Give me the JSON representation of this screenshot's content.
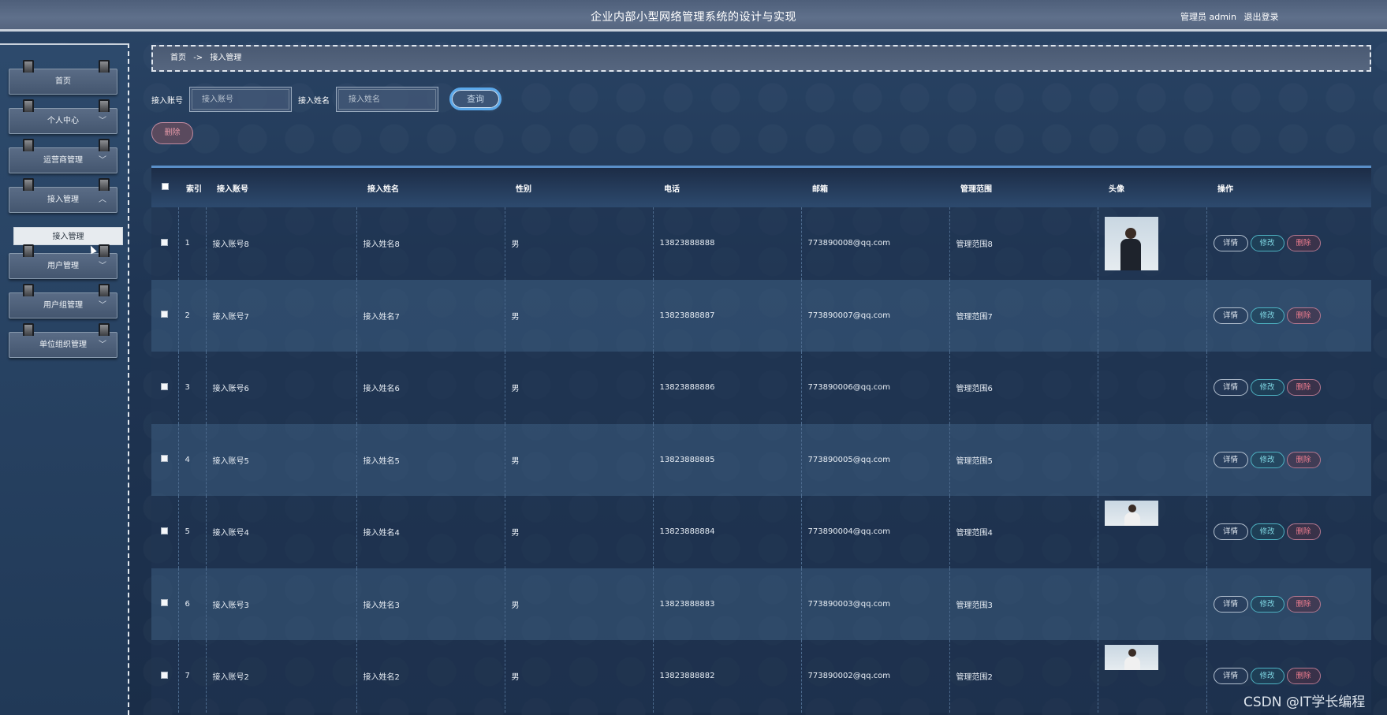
{
  "header": {
    "title": "企业内部小型网络管理系统的设计与实现",
    "user_label": "管理员 admin",
    "logout_label": "退出登录"
  },
  "sidebar": {
    "items": [
      {
        "label": "首页",
        "has_chevron": false
      },
      {
        "label": "个人中心",
        "chevron": "﹀"
      },
      {
        "label": "运营商管理",
        "chevron": "﹀"
      },
      {
        "label": "接入管理",
        "chevron": "︿"
      },
      {
        "label": "用户管理",
        "chevron": "﹀"
      },
      {
        "label": "用户组管理",
        "chevron": "﹀"
      },
      {
        "label": "单位组织管理",
        "chevron": "﹀"
      }
    ],
    "submenu": {
      "label": "接入管理"
    }
  },
  "breadcrumb": {
    "home": "首页",
    "separator": "->",
    "current": "接入管理"
  },
  "search": {
    "account_label": "接入账号",
    "account_placeholder": "接入账号",
    "name_label": "接入姓名",
    "name_placeholder": "接入姓名",
    "query_label": "查询"
  },
  "toolbar": {
    "delete_label": "删除"
  },
  "table": {
    "headers": [
      "索引",
      "接入账号",
      "接入姓名",
      "性别",
      "电话",
      "邮箱",
      "管理范围",
      "头像",
      "操作"
    ],
    "rows": [
      {
        "index": "1",
        "account": "接入账号8",
        "name": "接入姓名8",
        "gender": "男",
        "phone": "13823888888",
        "email": "773890008@qq.com",
        "scope": "管理范围8",
        "avatar": "tall"
      },
      {
        "index": "2",
        "account": "接入账号7",
        "name": "接入姓名7",
        "gender": "男",
        "phone": "13823888887",
        "email": "773890007@qq.com",
        "scope": "管理范围7",
        "avatar": "none"
      },
      {
        "index": "3",
        "account": "接入账号6",
        "name": "接入姓名6",
        "gender": "男",
        "phone": "13823888886",
        "email": "773890006@qq.com",
        "scope": "管理范围6",
        "avatar": "none"
      },
      {
        "index": "4",
        "account": "接入账号5",
        "name": "接入姓名5",
        "gender": "男",
        "phone": "13823888885",
        "email": "773890005@qq.com",
        "scope": "管理范围5",
        "avatar": "none"
      },
      {
        "index": "5",
        "account": "接入账号4",
        "name": "接入姓名4",
        "gender": "男",
        "phone": "13823888884",
        "email": "773890004@qq.com",
        "scope": "管理范围4",
        "avatar": "short"
      },
      {
        "index": "6",
        "account": "接入账号3",
        "name": "接入姓名3",
        "gender": "男",
        "phone": "13823888883",
        "email": "773890003@qq.com",
        "scope": "管理范围3",
        "avatar": "none"
      },
      {
        "index": "7",
        "account": "接入账号2",
        "name": "接入姓名2",
        "gender": "男",
        "phone": "13823888882",
        "email": "773890002@qq.com",
        "scope": "管理范围2",
        "avatar": "short"
      }
    ],
    "actions": {
      "detail": "详情",
      "edit": "修改",
      "delete": "删除"
    }
  },
  "watermark": "CSDN @IT学长编程"
}
